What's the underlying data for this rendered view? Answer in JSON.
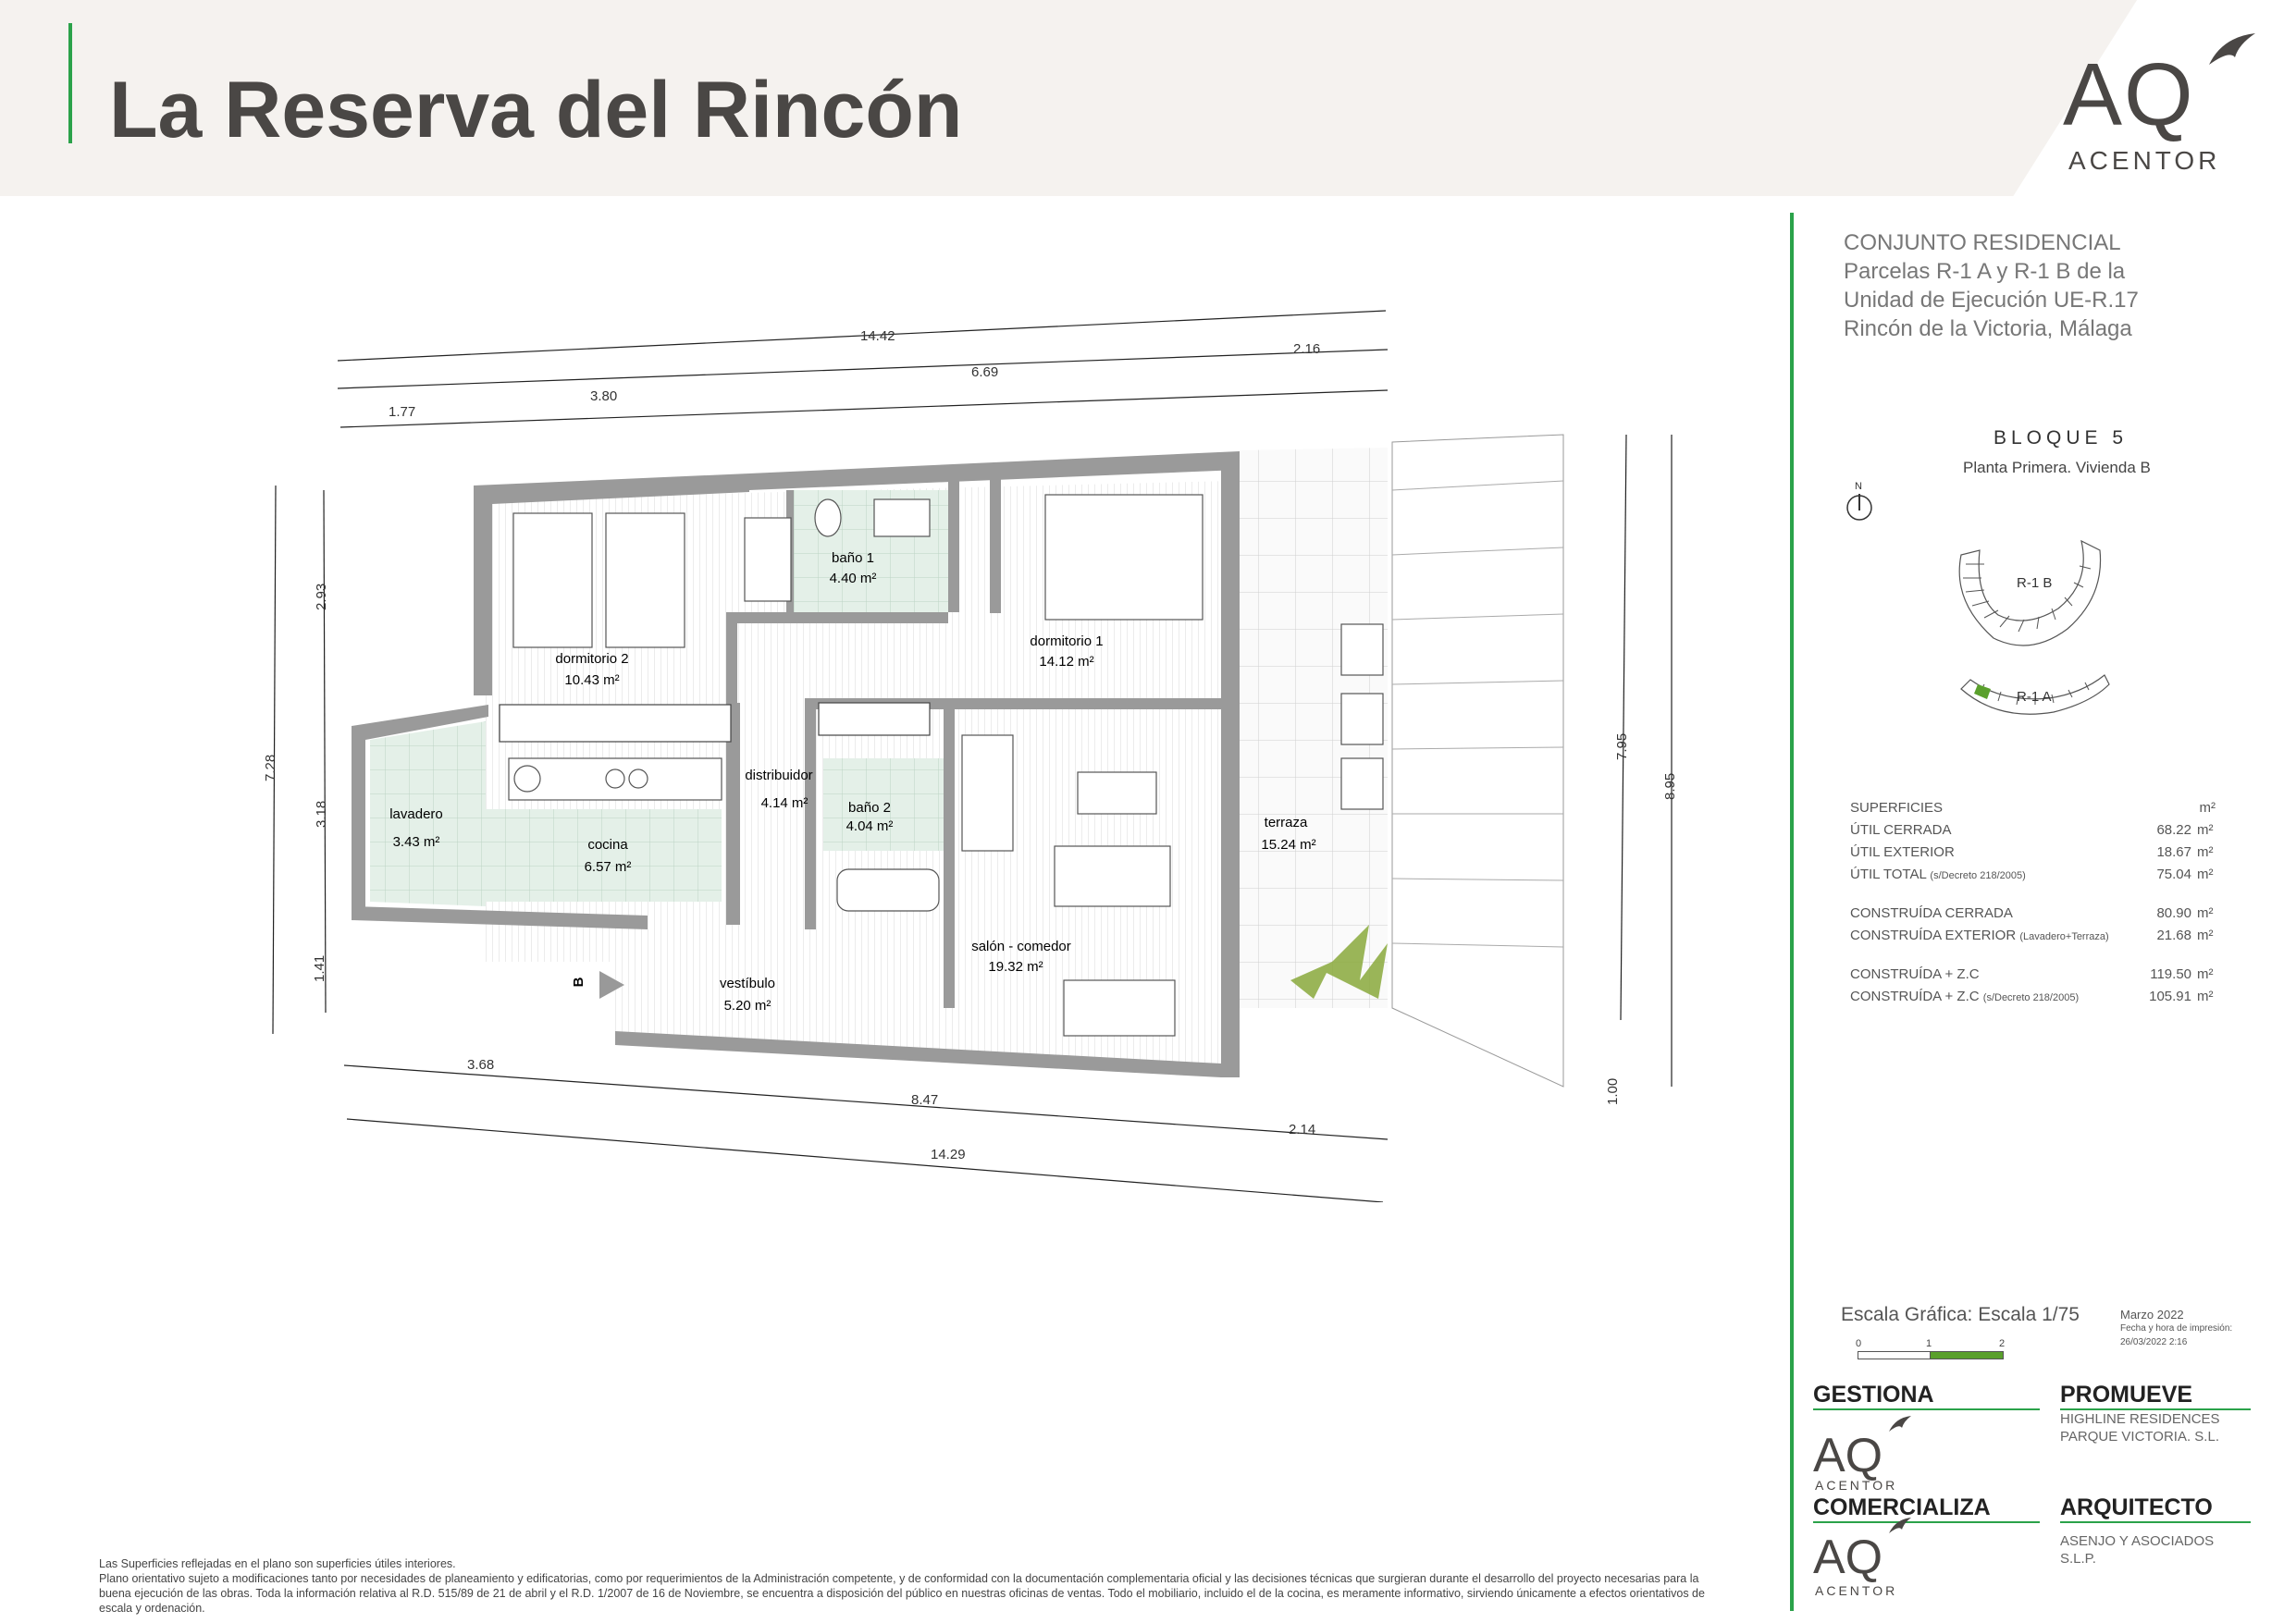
{
  "header": {
    "title": "La Reserva del Rincón",
    "logo_mark": "AQ",
    "logo_name": "ACENTOR"
  },
  "project": {
    "lines": [
      "CONJUNTO RESIDENCIAL",
      "Parcelas R-1 A y R-1 B de la",
      "Unidad de Ejecución UE-R.17",
      "Rincón de la Victoria, Málaga"
    ]
  },
  "block": {
    "title": "BLOQUE 5",
    "subtitle": "Planta Primera. Vivienda B",
    "north": "N",
    "parcel_b": "R-1 B",
    "parcel_a": "R-1 A"
  },
  "surfaces": {
    "header": "SUPERFICIES",
    "unit": "m²",
    "rows": [
      {
        "label": "ÚTIL CERRADA",
        "note": "",
        "value": "68.22",
        "unit": "m²"
      },
      {
        "label": "ÚTIL EXTERIOR",
        "note": "",
        "value": "18.67",
        "unit": "m²"
      },
      {
        "label": "ÚTIL TOTAL",
        "note": "(s/Decreto 218/2005)",
        "value": "75.04",
        "unit": "m²"
      },
      {
        "label": "CONSTRUÍDA CERRADA",
        "note": "",
        "value": "80.90",
        "unit": "m²"
      },
      {
        "label": "CONSTRUÍDA EXTERIOR",
        "note": "(Lavadero+Terraza)",
        "value": "21.68",
        "unit": "m²"
      },
      {
        "label": "CONSTRUÍDA + Z.C",
        "note": "",
        "value": "119.50",
        "unit": "m²"
      },
      {
        "label": "CONSTRUÍDA + Z.C",
        "note": "(s/Decreto 218/2005)",
        "value": "105.91",
        "unit": "m²"
      }
    ]
  },
  "scale": {
    "label": "Escala Gráfica: Escala  1/75",
    "ticks": [
      "0",
      "1",
      "2"
    ],
    "date": "Marzo 2022",
    "print_label": "Fecha y hora de impresión:",
    "print_date": "26/03/2022 2:16"
  },
  "credits": {
    "gestiona": {
      "title": "GESTIONA",
      "logo_mark": "AQ",
      "logo_name": "ACENTOR"
    },
    "promueve": {
      "title": "PROMUEVE",
      "lines": [
        "HIGHLINE RESIDENCES",
        "PARQUE VICTORIA. S.L."
      ]
    },
    "comercializa": {
      "title": "COMERCIALIZA",
      "logo_mark": "AQ",
      "logo_name": "ACENTOR"
    },
    "arquitecto": {
      "title": "ARQUITECTO",
      "lines": [
        "ASENJO Y ASOCIADOS S.L.P."
      ]
    }
  },
  "footer": {
    "line1": "Las Superficies reflejadas en el plano son superficies útiles interiores.",
    "line2": "Plano orientativo sujeto a modificaciones tanto por necesidades de planeamiento y edificatorias, como por requerimientos de la Administración competente, y de conformidad con la documentación complementaria oficial y las decisiones técnicas que surgieran durante el desarrollo del proyecto necesarias para la buena ejecución de las obras. Toda la información relativa al R.D. 515/89 de 21 de abril y el R.D. 1/2007 de 16 de Noviembre, se encuentra a disposición del público en nuestras oficinas de ventas. Todo el mobiliario, incluido el de la cocina, es meramente informativo, sirviendo únicamente a efectos orientativos de escala y ordenación."
  },
  "plan": {
    "rooms": [
      {
        "name": "dormitorio 2",
        "area": "10.43 m²"
      },
      {
        "name": "baño 1",
        "area": "4.40 m²"
      },
      {
        "name": "dormitorio 1",
        "area": "14.12 m²"
      },
      {
        "name": "distribuidor",
        "area": "4.14 m²"
      },
      {
        "name": "baño 2",
        "area": "4.04 m²"
      },
      {
        "name": "lavadero",
        "area": "3.43 m²"
      },
      {
        "name": "cocina",
        "area": "6.57 m²"
      },
      {
        "name": "terraza",
        "area": "15.24 m²"
      },
      {
        "name": "salón - comedor",
        "area": "19.32 m²"
      },
      {
        "name": "vestíbulo",
        "area": "5.20 m²"
      }
    ],
    "entry_marker": "B",
    "dims_top": [
      "14.42",
      "1.77",
      "3.80",
      "6.69",
      "2.16"
    ],
    "dims_bottom": [
      "3.68",
      "8.47",
      "2.14",
      "14.29"
    ],
    "dims_left": [
      "7.28",
      "2.93",
      "3.18",
      "1.41"
    ],
    "dims_right": [
      "7.95",
      "8.95",
      "1.00"
    ]
  }
}
